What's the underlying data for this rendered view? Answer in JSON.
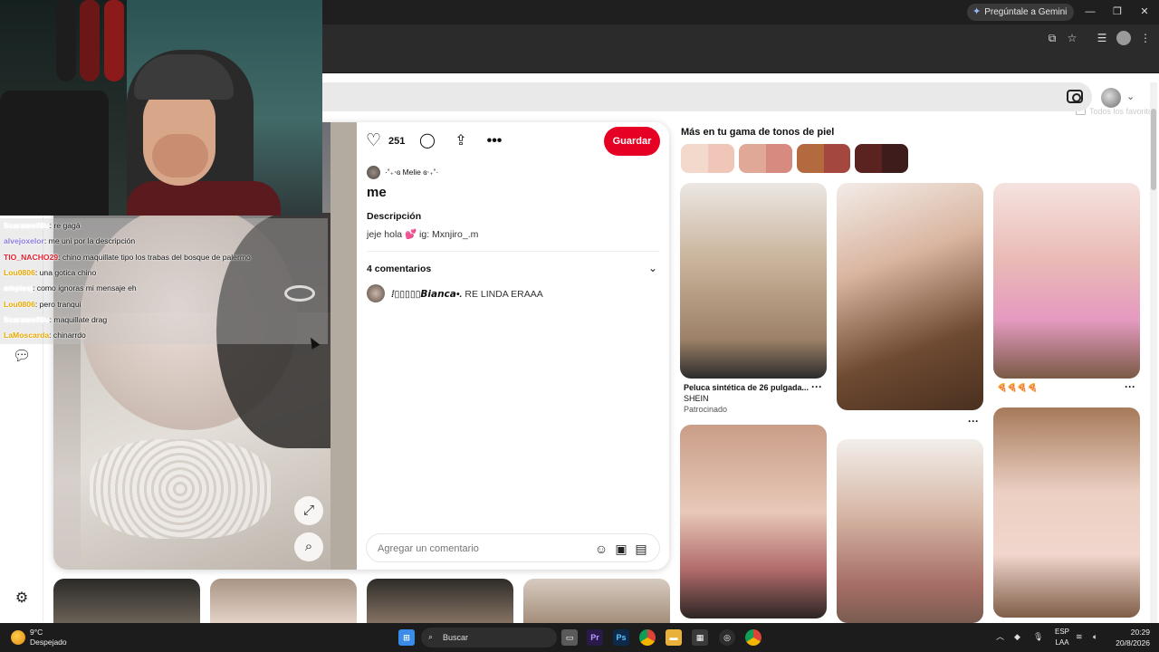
{
  "browser": {
    "gemini_label": "Pregúntale a Gemini",
    "favorites_label": "Todos los favoritos"
  },
  "stream_chat": {
    "messages": [
      {
        "user": "Scaramell0u",
        "text": ": re gagá",
        "color": "#ffffff"
      },
      {
        "user": "alvejoxelor",
        "text": ": me uni por la descripción",
        "color": "#8a7be0"
      },
      {
        "user": "TIO_NACHO29",
        "text": ": chino maquillate tipo los trabas del bosque de palermo",
        "color": "#e0232f"
      },
      {
        "user": "Lou0806",
        "text": ": una gotica chino",
        "color": "#e8a800"
      },
      {
        "user": "ampissj",
        "text": ": como ignoras mi mensaje eh",
        "color": "#ffffff"
      },
      {
        "user": "Lou0806",
        "text": ": pero tranqui",
        "color": "#e8a800"
      },
      {
        "user": "Scaramell0u",
        "text": ": maquillate drag",
        "color": "#ffffff"
      },
      {
        "user": "LaMoscarda",
        "text": ": chinarrdo",
        "color": "#e8a800"
      }
    ]
  },
  "pin": {
    "likes": "251",
    "save_label": "Guardar",
    "author": "·˚₊‧ɞ Melie ɞ‧₊˚·",
    "title": "me",
    "description_heading": "Descripción",
    "description_text": "jeje hola 💕 ig: Mxnjiro_.m",
    "comments_heading": "4 comentarios",
    "comment_user": "⁞▯▯▯▯▯𝘽𝙞𝙖𝙣𝙘𝙖•.",
    "comment_text": " RE LINDA ERAAA",
    "comment_placeholder": "Agregar un comentario"
  },
  "related": {
    "heading": "Más en tu gama de tonos de piel",
    "swatches": [
      [
        "#f3d9cc",
        "#f0c6b8"
      ],
      [
        "#e0a896",
        "#d68a80"
      ],
      [
        "#b26a3e",
        "#a4473e"
      ],
      [
        "#5a2320",
        "#3d1c1b"
      ]
    ],
    "ad_title": "Peluca sintética de 26 pulgada...",
    "ad_brand": "SHEIN",
    "ad_sponsored": "Patrocinado",
    "emoji_caption": "🍕🍕🍕🍕"
  },
  "taskbar": {
    "temperature": "9°C",
    "weather": "Despejado",
    "search_label": "Buscar",
    "lang_top": "ESP",
    "lang_bottom": "LAA",
    "time": "20:29",
    "date": "20/8/2026"
  },
  "colors": {
    "pinterest_red": "#e60023",
    "taskbar": "#1c1c1c",
    "chrome_dark": "#2b2b2b"
  }
}
